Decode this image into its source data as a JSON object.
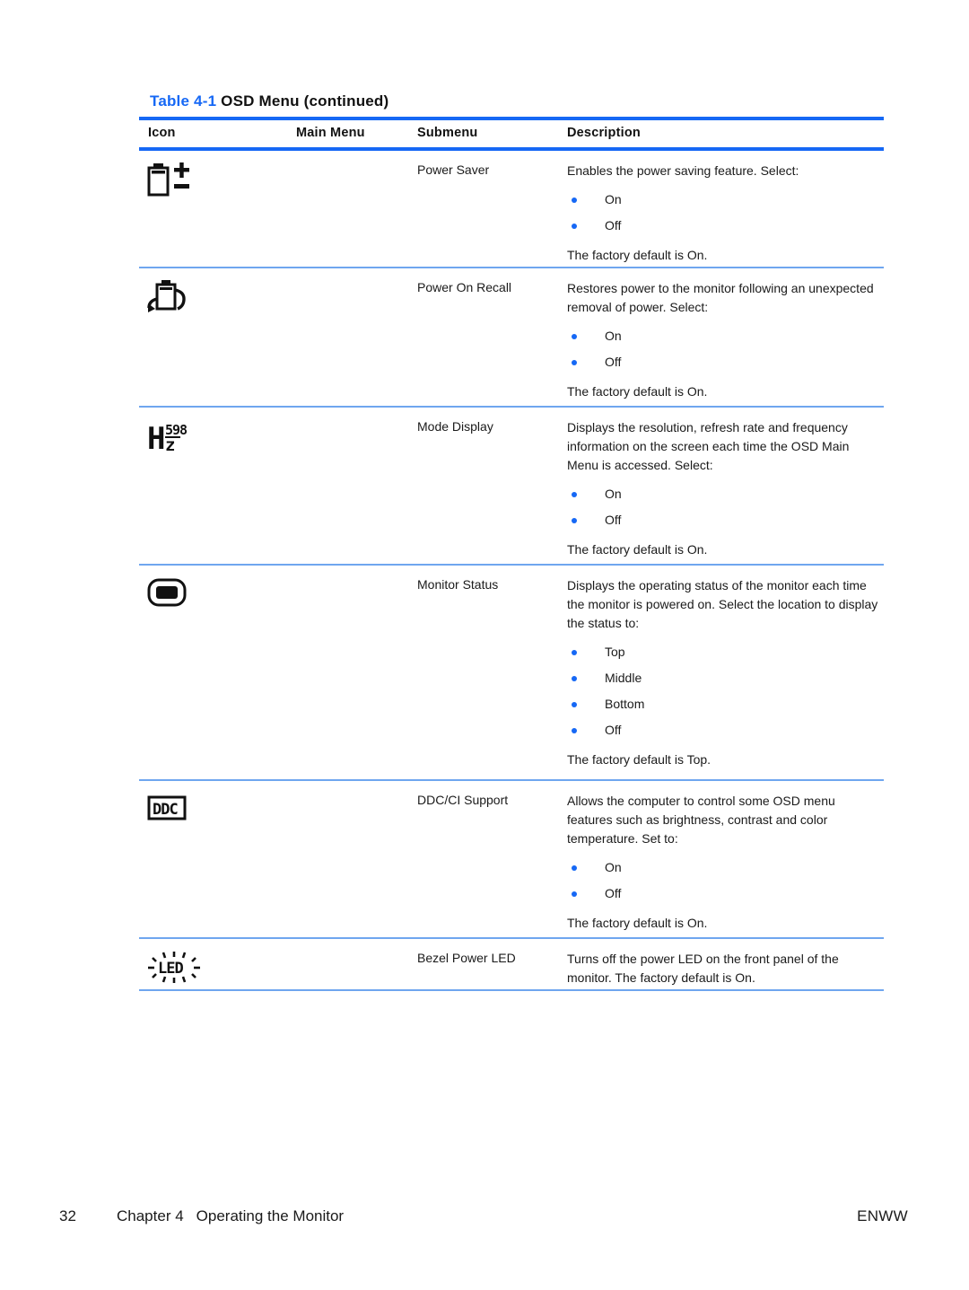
{
  "document": {
    "table_caption": {
      "label": "Table 4-1",
      "title": "OSD Menu (continued)"
    },
    "accent_color": "#1668f5",
    "rule_light_color": "#6fa6ef"
  },
  "table": {
    "headers": {
      "icon": "Icon",
      "main_menu": "Main Menu",
      "submenu": "Submenu",
      "description": "Description"
    },
    "rows": [
      {
        "icon_name": "battery-plus-minus-icon",
        "main_menu": "",
        "submenu": "Power Saver",
        "description_lead": "Enables the power saving feature. Select:",
        "options": [
          "On",
          "Off"
        ],
        "description_tail": "The factory default is On."
      },
      {
        "icon_name": "battery-recall-arrow-icon",
        "main_menu": "",
        "submenu": "Power On Recall",
        "description_lead": "Restores power to the monitor following an unexpected removal of power. Select:",
        "options": [
          "On",
          "Off"
        ],
        "description_tail": "The factory default is On."
      },
      {
        "icon_name": "hz-frequency-icon",
        "main_menu": "",
        "submenu": "Mode Display",
        "description_lead": "Displays the resolution, refresh rate and frequency information on the screen each time the OSD Main Menu is accessed. Select:",
        "options": [
          "On",
          "Off"
        ],
        "description_tail": "The factory default is On."
      },
      {
        "icon_name": "monitor-status-icon",
        "main_menu": "",
        "submenu": "Monitor Status",
        "description_lead": "Displays the operating status of the monitor each time the monitor is powered on. Select the location to display the status to:",
        "options": [
          "Top",
          "Middle",
          "Bottom",
          "Off"
        ],
        "description_tail": "The factory default is Top."
      },
      {
        "icon_name": "ddc-box-icon",
        "main_menu": "",
        "submenu": "DDC/CI Support",
        "description_lead": "Allows the computer to control some OSD menu features such as brightness, contrast and color temperature. Set to:",
        "options": [
          "On",
          "Off"
        ],
        "description_tail": "The factory default is On."
      },
      {
        "icon_name": "bezel-power-led-icon",
        "main_menu": "",
        "submenu": "Bezel Power LED",
        "description_lead": "Turns off the power LED on the front panel of the monitor. The factory default is On.",
        "options": [],
        "description_tail": ""
      }
    ]
  },
  "footer": {
    "page_number": "32",
    "chapter_number": "Chapter 4",
    "chapter_title": "Operating the Monitor",
    "right_label": "ENWW"
  }
}
